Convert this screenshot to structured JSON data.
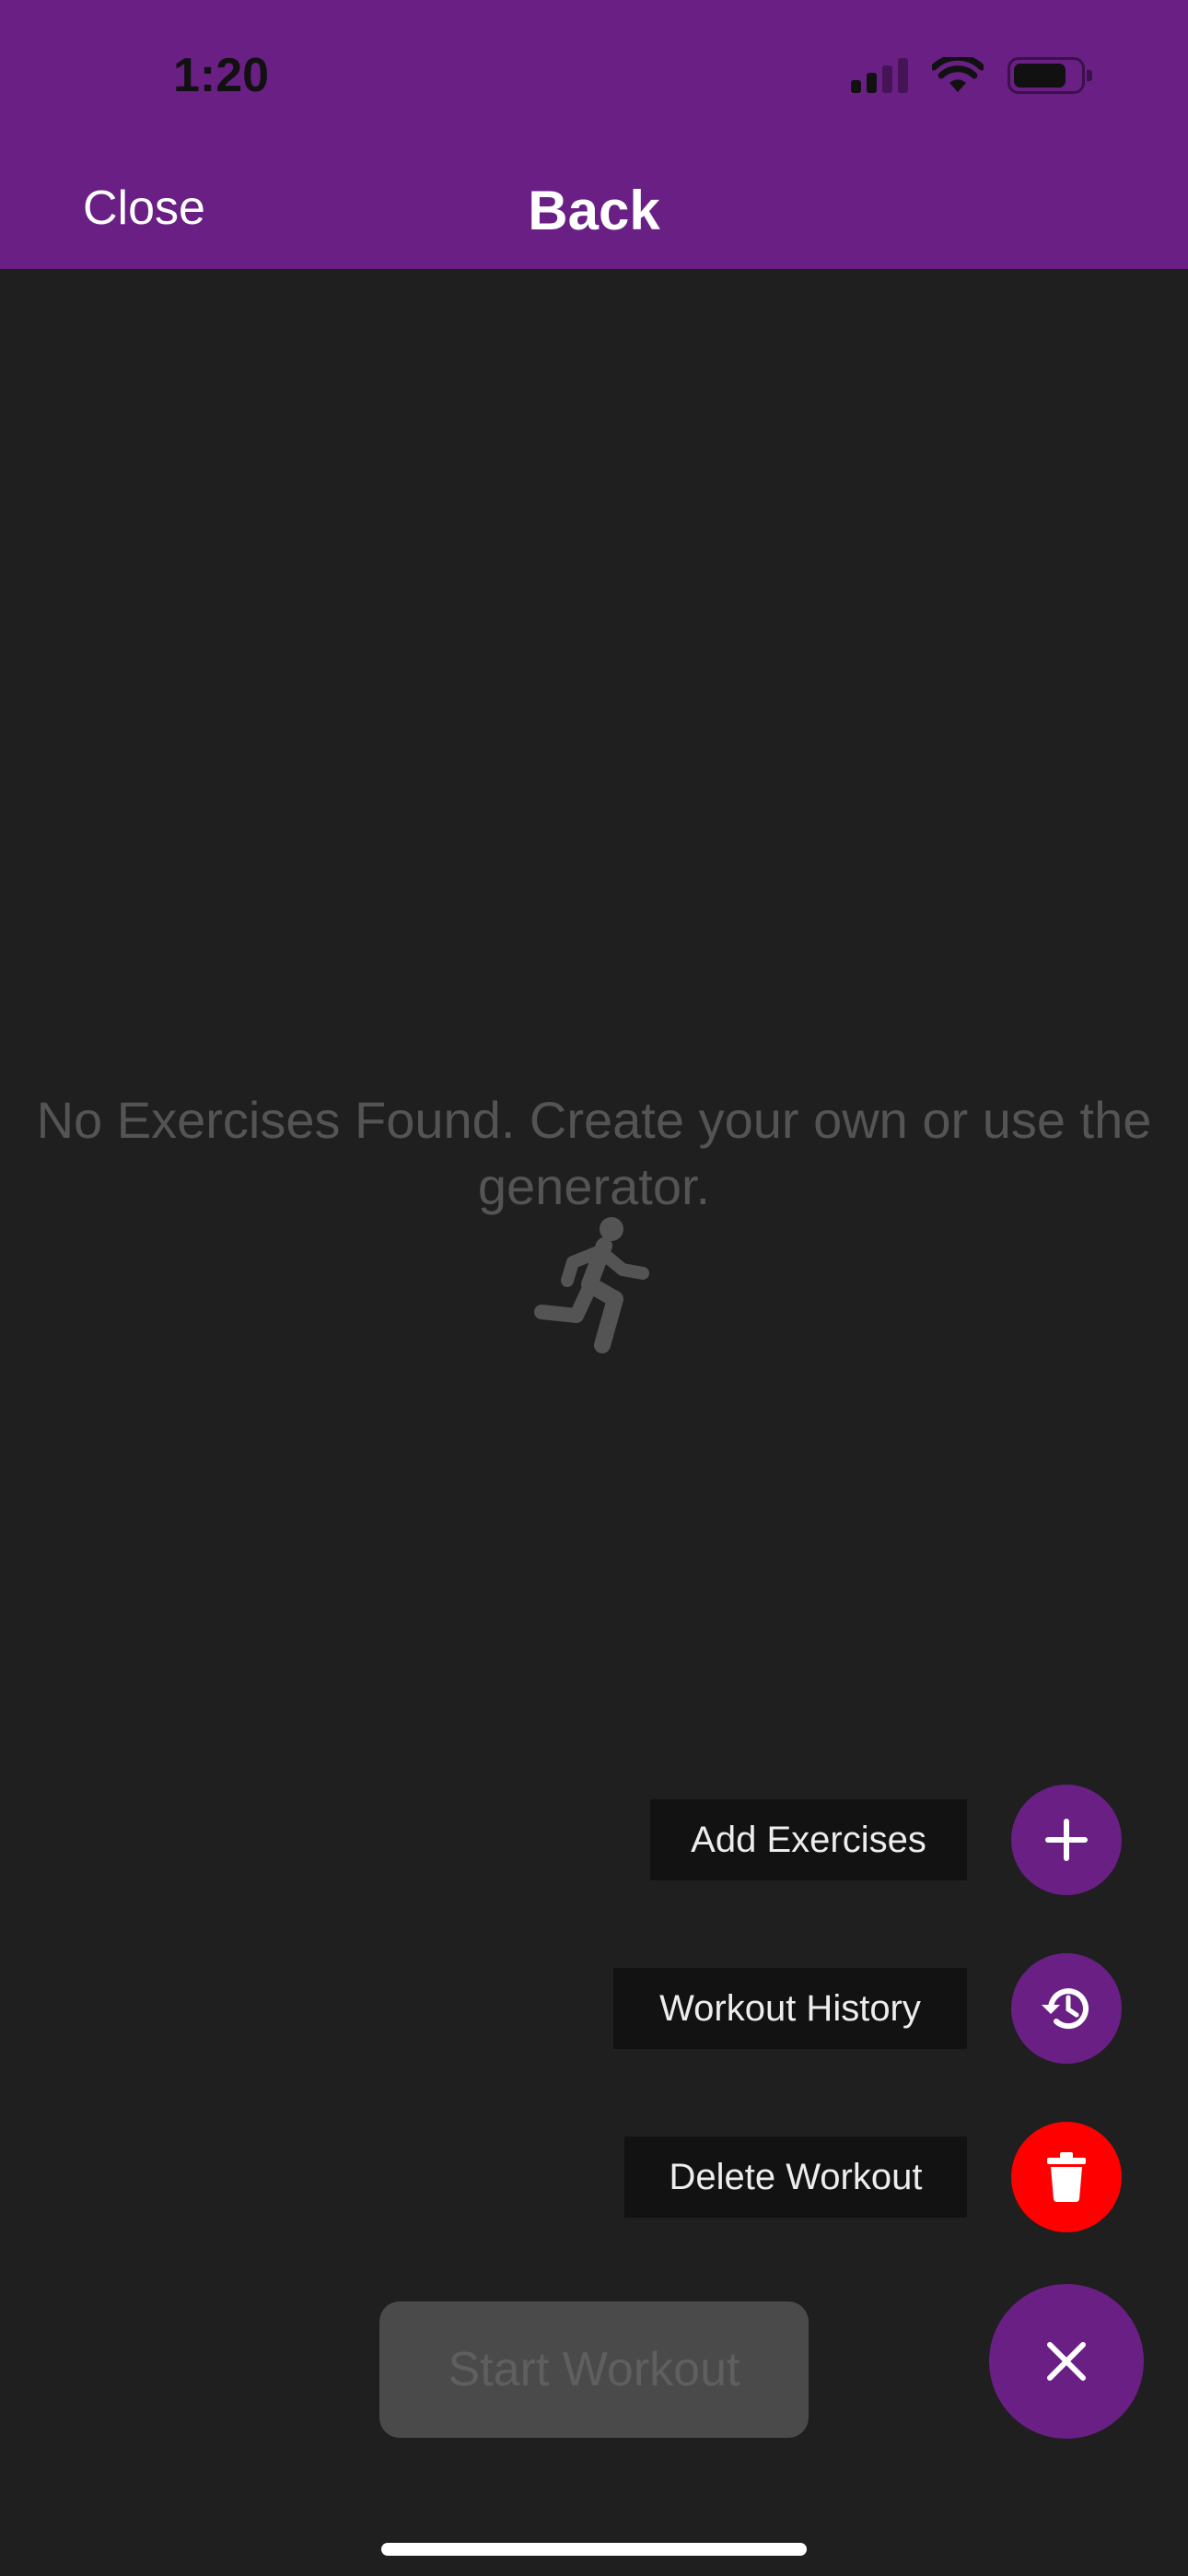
{
  "status_bar": {
    "time": "1:20"
  },
  "nav": {
    "close_label": "Close",
    "title": "Back"
  },
  "empty_state": {
    "message": "No Exercises Found. Create your own or use the generator.",
    "icon": "running-person-icon"
  },
  "fab_menu": {
    "items": [
      {
        "label": "Add Exercises",
        "icon": "plus-icon",
        "color": "#6a1f85"
      },
      {
        "label": "Workout History",
        "icon": "history-icon",
        "color": "#6a1f85"
      },
      {
        "label": "Delete Workout",
        "icon": "trash-icon",
        "color": "#ff0000"
      }
    ],
    "toggle_icon": "close-icon"
  },
  "start_button": {
    "label": "Start Workout",
    "enabled": false
  },
  "colors": {
    "header": "#6a1f85",
    "background": "#1f1f1f",
    "danger": "#ff0000"
  }
}
